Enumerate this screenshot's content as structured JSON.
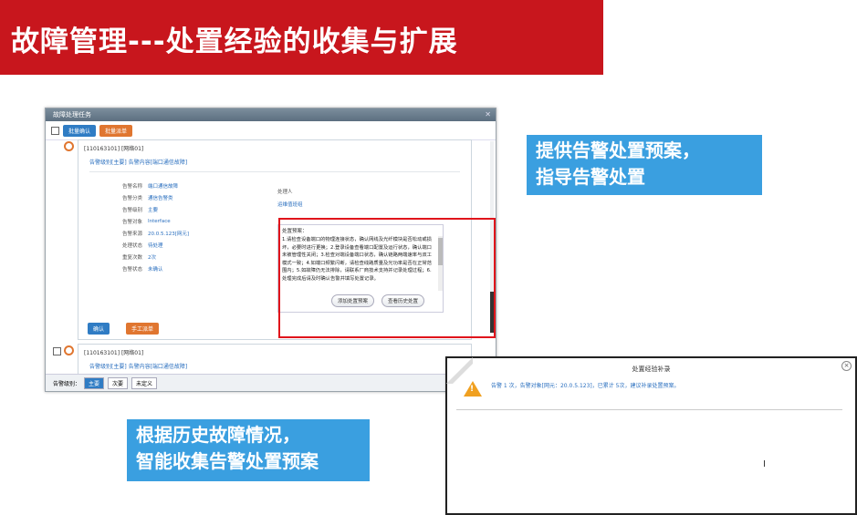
{
  "slide": {
    "title": "故障管理---处置经验的收集与扩展",
    "callout_top": [
      "提供告警处置预案，",
      "指导告警处置"
    ],
    "callout_bottom": [
      "根据历史故障情况，",
      "智能收集告警处置预案"
    ]
  },
  "main_window": {
    "title": "故障处理任务",
    "toolbar": {
      "btn1": "批量确认",
      "btn2": "批量派单"
    },
    "record1": {
      "head": "[110163101] [网络01]",
      "link": "告警级别[主要] 告警内容[端口通信故障]",
      "fields_left": [
        {
          "label": "告警名称",
          "value": "端口通信故障"
        },
        {
          "label": "告警分类",
          "value": "通信告警类"
        },
        {
          "label": "告警级别",
          "value": "主要"
        },
        {
          "label": "告警对象",
          "value": "Interface"
        },
        {
          "label": "告警来源",
          "value": "20.0.5.123[网元]"
        },
        {
          "label": "处理状态",
          "value": "待处理"
        },
        {
          "label": "重复次数",
          "value": "2次"
        },
        {
          "label": "告警状态",
          "value": "未确认"
        }
      ],
      "right_label": "处理人",
      "right_value": "运维值班组",
      "plan_label": "处置预案：",
      "plan_text": "1.请检查设备端口的物理连接状态，确认网线及光纤模块是否松动或损坏，必要时进行更换；2.登录设备查看端口配置及运行状态，确认端口未被管理性关闭；3.检查对端设备端口状态，确认链路两端速率与双工模式一致；4.如端口频繁闪断，请检查线路质量及光功率是否在正常范围内；5.如故障仍无法排除，请联系厂商技术支持并记录处理过程；6.处理完成后请及时确认告警并填写处置记录。",
      "plan_btn1": "添加处置预案",
      "plan_btn2": "查看历史处置",
      "btn_ok": "确认",
      "btn_dispatch": "手工派单"
    },
    "record2": {
      "head": "[110163101] [网络01]",
      "link": "告警级别[主要] 告警内容[端口通信故障]"
    },
    "footer": {
      "label": "告警级别：",
      "b1": "主要",
      "b2": "次要",
      "b3": "未定义"
    }
  },
  "popup": {
    "title": "处置经验补录",
    "message": "告警 1 次，告警对象[网元：20.0.5.123]，已累计 5次，建议补录处置预案。",
    "cursor": "I"
  },
  "colors": {
    "title_bg": "#c8161d",
    "callout_bg": "#3a9fe0",
    "highlight": "#e0141b"
  }
}
